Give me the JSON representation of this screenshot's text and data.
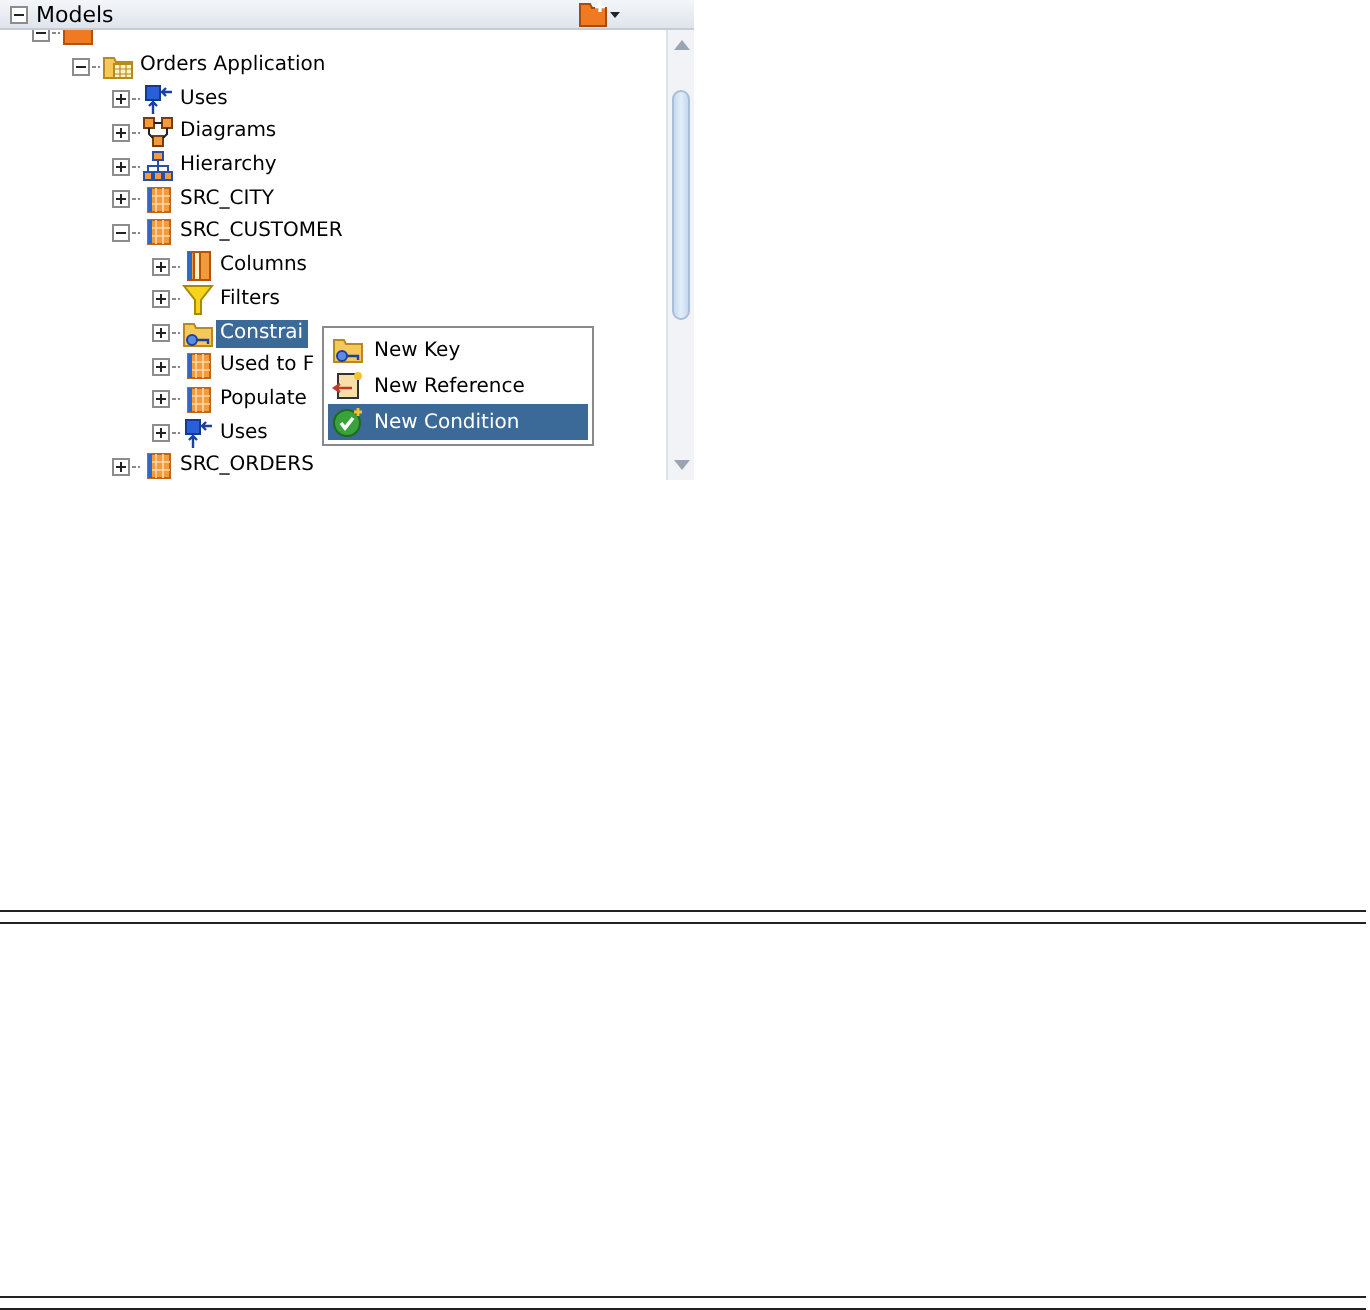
{
  "panel": {
    "title": "Models",
    "expanded": true
  },
  "tree": [
    {
      "kind": "model",
      "expanded": true,
      "selected": false,
      "children": [
        {
          "label": "Orders Application",
          "kind": "folder",
          "expanded": true,
          "selected": false,
          "children": [
            {
              "label": "Uses",
              "kind": "uses",
              "expanded": false,
              "selected": false
            },
            {
              "label": "Diagrams",
              "kind": "diagrams",
              "expanded": false,
              "selected": false
            },
            {
              "label": "Hierarchy",
              "kind": "hierarchy",
              "expanded": false,
              "selected": false
            },
            {
              "label": "SRC_CITY",
              "kind": "datastore",
              "expanded": false,
              "selected": false
            },
            {
              "label": "SRC_CUSTOMER",
              "kind": "datastore",
              "expanded": true,
              "selected": false,
              "children": [
                {
                  "label": "Columns",
                  "kind": "columns",
                  "expanded": false,
                  "selected": false
                },
                {
                  "label": "Filters",
                  "kind": "filter",
                  "expanded": false,
                  "selected": false
                },
                {
                  "label": "Constrai",
                  "kind": "constraints",
                  "expanded": false,
                  "selected": true
                },
                {
                  "label": "Used to F",
                  "kind": "table",
                  "expanded": false,
                  "selected": false
                },
                {
                  "label": "Populate",
                  "kind": "table",
                  "expanded": false,
                  "selected": false
                },
                {
                  "label": "Uses",
                  "kind": "uses",
                  "expanded": false,
                  "selected": false
                }
              ]
            },
            {
              "label": "SRC_ORDERS",
              "kind": "datastore",
              "expanded": false,
              "selected": false
            }
          ]
        }
      ]
    }
  ],
  "context_menu": [
    {
      "label": "New Key",
      "kind": "key",
      "selected": false
    },
    {
      "label": "New Reference",
      "kind": "reference",
      "selected": false
    },
    {
      "label": "New Condition",
      "kind": "condition",
      "selected": true
    }
  ]
}
